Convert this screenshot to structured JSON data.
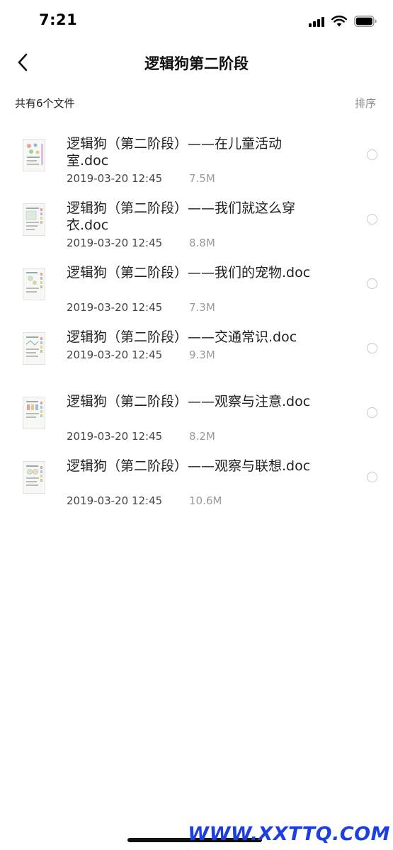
{
  "status_bar": {
    "time": "7:21"
  },
  "nav": {
    "title": "逻辑狗第二阶段",
    "back_icon": "chevron-left-icon"
  },
  "sub_header": {
    "count_text": "共有6个文件",
    "sort_label": "排序"
  },
  "files": [
    {
      "name": "逻辑狗（第二阶段）——在儿童活动室.doc",
      "date": "2019-03-20 12:45",
      "size": "7.5M"
    },
    {
      "name": "逻辑狗（第二阶段）——我们就这么穿衣.doc",
      "date": "2019-03-20 12:45",
      "size": "8.8M"
    },
    {
      "name": "逻辑狗（第二阶段）——我们的宠物.doc",
      "date": "2019-03-20 12:45",
      "size": "7.3M"
    },
    {
      "name": "逻辑狗（第二阶段）——交通常识.doc",
      "date": "2019-03-20 12:45",
      "size": "9.3M"
    },
    {
      "name": "逻辑狗（第二阶段）——观察与注意.doc",
      "date": "2019-03-20 12:45",
      "size": "8.2M"
    },
    {
      "name": "逻辑狗（第二阶段）——观察与联想.doc",
      "date": "2019-03-20 12:45",
      "size": "10.6M"
    }
  ],
  "watermark": "WWW.XXTTQ.COM"
}
